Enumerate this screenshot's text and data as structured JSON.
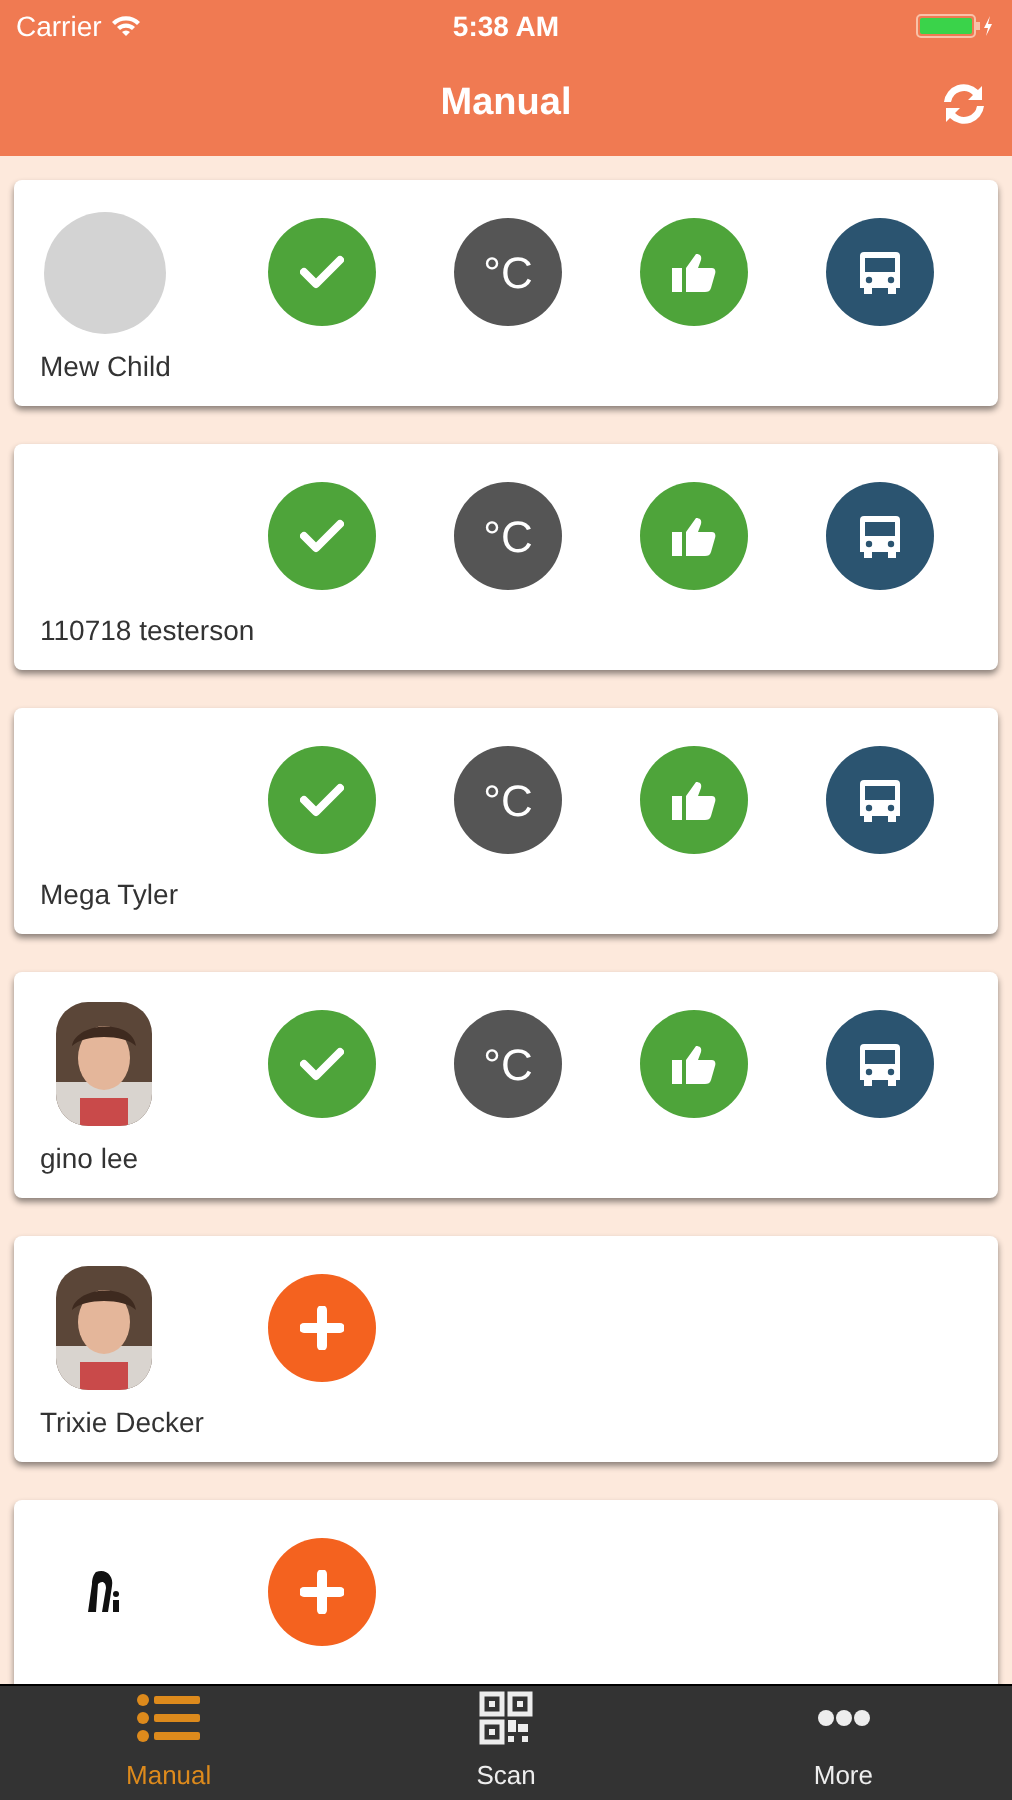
{
  "status_bar": {
    "carrier": "Carrier",
    "time": "5:38 AM"
  },
  "nav_bar": {
    "title": "Manual"
  },
  "cards": [
    {
      "name": "Mew Child",
      "avatar": {
        "kind": "placeholder"
      },
      "actions": [
        {
          "kind": "check"
        },
        {
          "kind": "temperature",
          "label": "°C"
        },
        {
          "kind": "like"
        },
        {
          "kind": "bus"
        }
      ]
    },
    {
      "name": "110718 testerson",
      "avatar": {
        "kind": "none"
      },
      "actions": [
        {
          "kind": "check"
        },
        {
          "kind": "temperature",
          "label": "°C"
        },
        {
          "kind": "like"
        },
        {
          "kind": "bus"
        }
      ]
    },
    {
      "name": "Mega Tyler",
      "avatar": {
        "kind": "none"
      },
      "actions": [
        {
          "kind": "check"
        },
        {
          "kind": "temperature",
          "label": "°C"
        },
        {
          "kind": "like"
        },
        {
          "kind": "bus"
        }
      ]
    },
    {
      "name": "gino lee",
      "actions": [
        {
          "kind": "check"
        },
        {
          "kind": "temperature",
          "label": "°C"
        },
        {
          "kind": "like"
        },
        {
          "kind": "bus"
        }
      ]
    },
    {
      "name": "Trixie Decker",
      "actions": [
        {
          "kind": "add"
        }
      ]
    },
    {
      "avatar": {
        "kind": "logo"
      },
      "actions": [
        {
          "kind": "add"
        }
      ]
    }
  ],
  "tabs": [
    {
      "label": "Manual",
      "kind": "list",
      "selected": true
    },
    {
      "label": "Scan",
      "kind": "qr",
      "selected": false
    },
    {
      "label": "More",
      "kind": "more",
      "selected": false
    }
  ]
}
